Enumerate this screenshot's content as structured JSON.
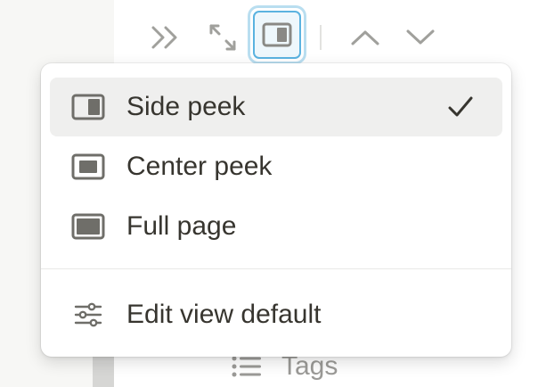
{
  "colors": {
    "text": "#37352f",
    "icon": "#6f6e69",
    "muted_icon": "#a0a09c",
    "selected_bg": "#efefee",
    "accent": "#5bb3e0"
  },
  "toolbar": {
    "icons": [
      "double-chevron-right-icon",
      "expand-arrows-icon",
      "side-peek-icon",
      "chevron-up-icon",
      "chevron-down-icon"
    ]
  },
  "menu": {
    "items": [
      {
        "label": "Side peek",
        "icon": "side-peek-icon",
        "selected": true
      },
      {
        "label": "Center peek",
        "icon": "center-peek-icon",
        "selected": false
      },
      {
        "label": "Full page",
        "icon": "full-page-icon",
        "selected": false
      }
    ],
    "footer": {
      "label": "Edit view default",
      "icon": "sliders-icon"
    }
  },
  "background": {
    "property_label": "Tags",
    "property_icon": "list-icon"
  }
}
